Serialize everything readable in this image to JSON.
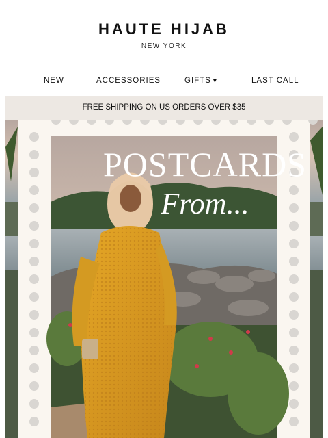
{
  "brand": {
    "name": "HAUTE HIJAB",
    "location": "NEW YORK"
  },
  "nav": {
    "items": [
      {
        "label": "NEW"
      },
      {
        "label": "ACCESSORIES"
      },
      {
        "label": "GIFTS",
        "icon": "chevron-down-icon"
      },
      {
        "label": "LAST CALL"
      }
    ]
  },
  "banner": {
    "text": "FREE SHIPPING ON US ORDERS OVER $35"
  },
  "hero": {
    "title_line1": "POSTCARDS",
    "title_line2": "From...",
    "colors": {
      "dress": "#d99a1f",
      "hijab": "#e8c9a8",
      "stamp": "#faf6f0",
      "sky": "#c9b6a8"
    }
  }
}
